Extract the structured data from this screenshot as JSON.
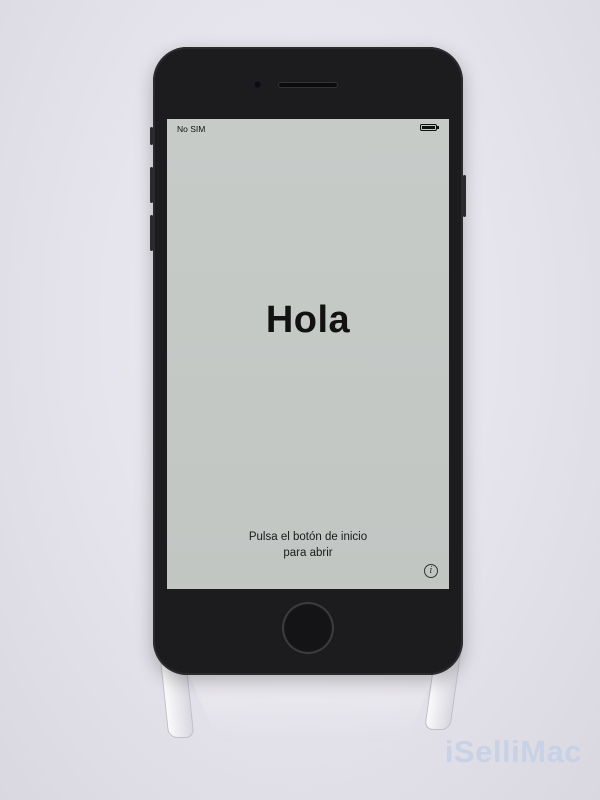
{
  "status_bar": {
    "carrier": "No SIM",
    "battery_level": 1.0
  },
  "screen": {
    "greeting": "Hola",
    "prompt_line1": "Pulsa el botón de inicio",
    "prompt_line2": "para abrir",
    "info_glyph": "i"
  },
  "icons": {
    "battery": "battery-icon",
    "info": "info-icon"
  },
  "watermark": {
    "text": "iSelliMac"
  },
  "colors": {
    "screen_bg": "#c4c8c5",
    "phone_body": "#1c1c1e",
    "watermark": "#c4d0e8"
  }
}
